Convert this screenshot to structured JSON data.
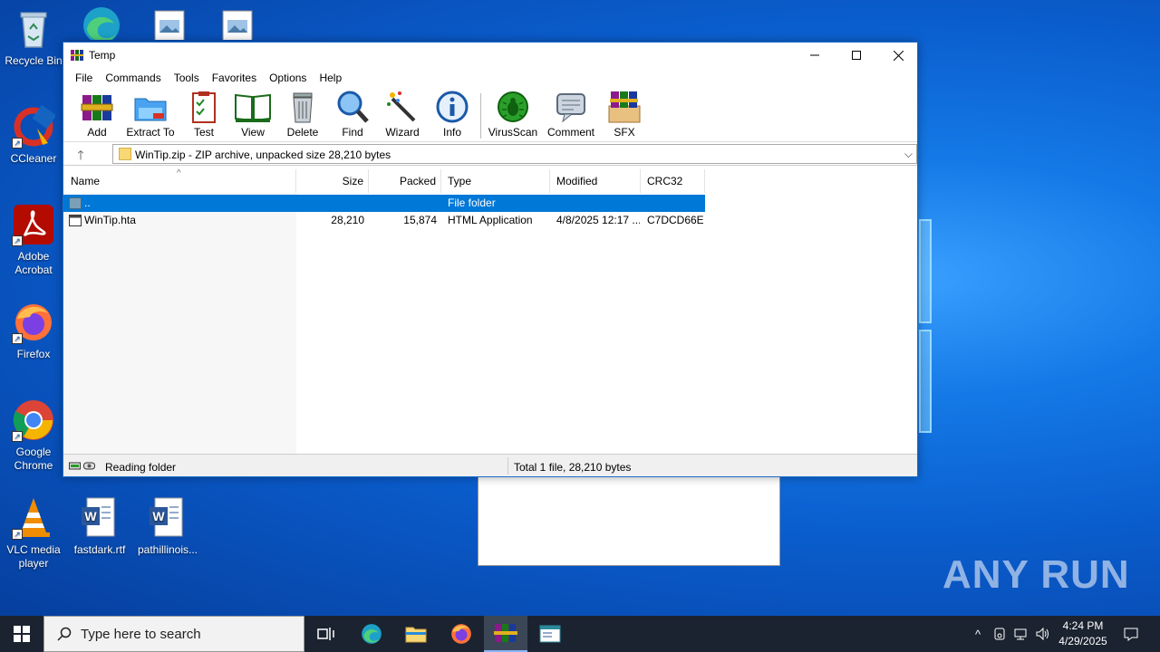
{
  "desktop": {
    "icons": [
      {
        "label": "Recycle Bin"
      },
      {
        "label": "CCleaner"
      },
      {
        "label": "Adobe Acrobat"
      },
      {
        "label": "Firefox"
      },
      {
        "label": "Google Chrome"
      },
      {
        "label": "VLC media player"
      },
      {
        "label": "fastdark.rtf"
      },
      {
        "label": "pathillinois..."
      }
    ],
    "watermark": "ANY RUN"
  },
  "window": {
    "title": "Temp",
    "menu": [
      "File",
      "Commands",
      "Tools",
      "Favorites",
      "Options",
      "Help"
    ],
    "toolbar": [
      {
        "label": "Add",
        "icon": "add-archive-icon"
      },
      {
        "label": "Extract To",
        "icon": "extract-folder-icon"
      },
      {
        "label": "Test",
        "icon": "test-clipboard-icon"
      },
      {
        "label": "View",
        "icon": "view-book-icon"
      },
      {
        "label": "Delete",
        "icon": "trash-icon"
      },
      {
        "label": "Find",
        "icon": "magnifier-icon"
      },
      {
        "label": "Wizard",
        "icon": "magic-wand-icon"
      },
      {
        "label": "Info",
        "icon": "info-icon"
      },
      {
        "label": "VirusScan",
        "icon": "bug-scan-icon"
      },
      {
        "label": "Comment",
        "icon": "comment-icon"
      },
      {
        "label": "SFX",
        "icon": "sfx-box-icon"
      }
    ],
    "address": "WinTip.zip - ZIP archive, unpacked size 28,210 bytes",
    "columns": [
      "Name",
      "Size",
      "Packed",
      "Type",
      "Modified",
      "CRC32"
    ],
    "rows": [
      {
        "name": "..",
        "size": "",
        "packed": "",
        "type": "File folder",
        "modified": "",
        "crc": "",
        "selected": true
      },
      {
        "name": "WinTip.hta",
        "size": "28,210",
        "packed": "15,874",
        "type": "HTML Application",
        "modified": "4/8/2025 12:17 ...",
        "crc": "C7DCD66E",
        "selected": false
      }
    ],
    "status_left": "Reading folder",
    "status_right": "Total 1 file, 28,210 bytes"
  },
  "taskbar": {
    "search_placeholder": "Type here to search",
    "time": "4:24 PM",
    "date": "4/29/2025"
  },
  "colors": {
    "selection": "#0078d7",
    "taskbar": "#1b2330"
  }
}
